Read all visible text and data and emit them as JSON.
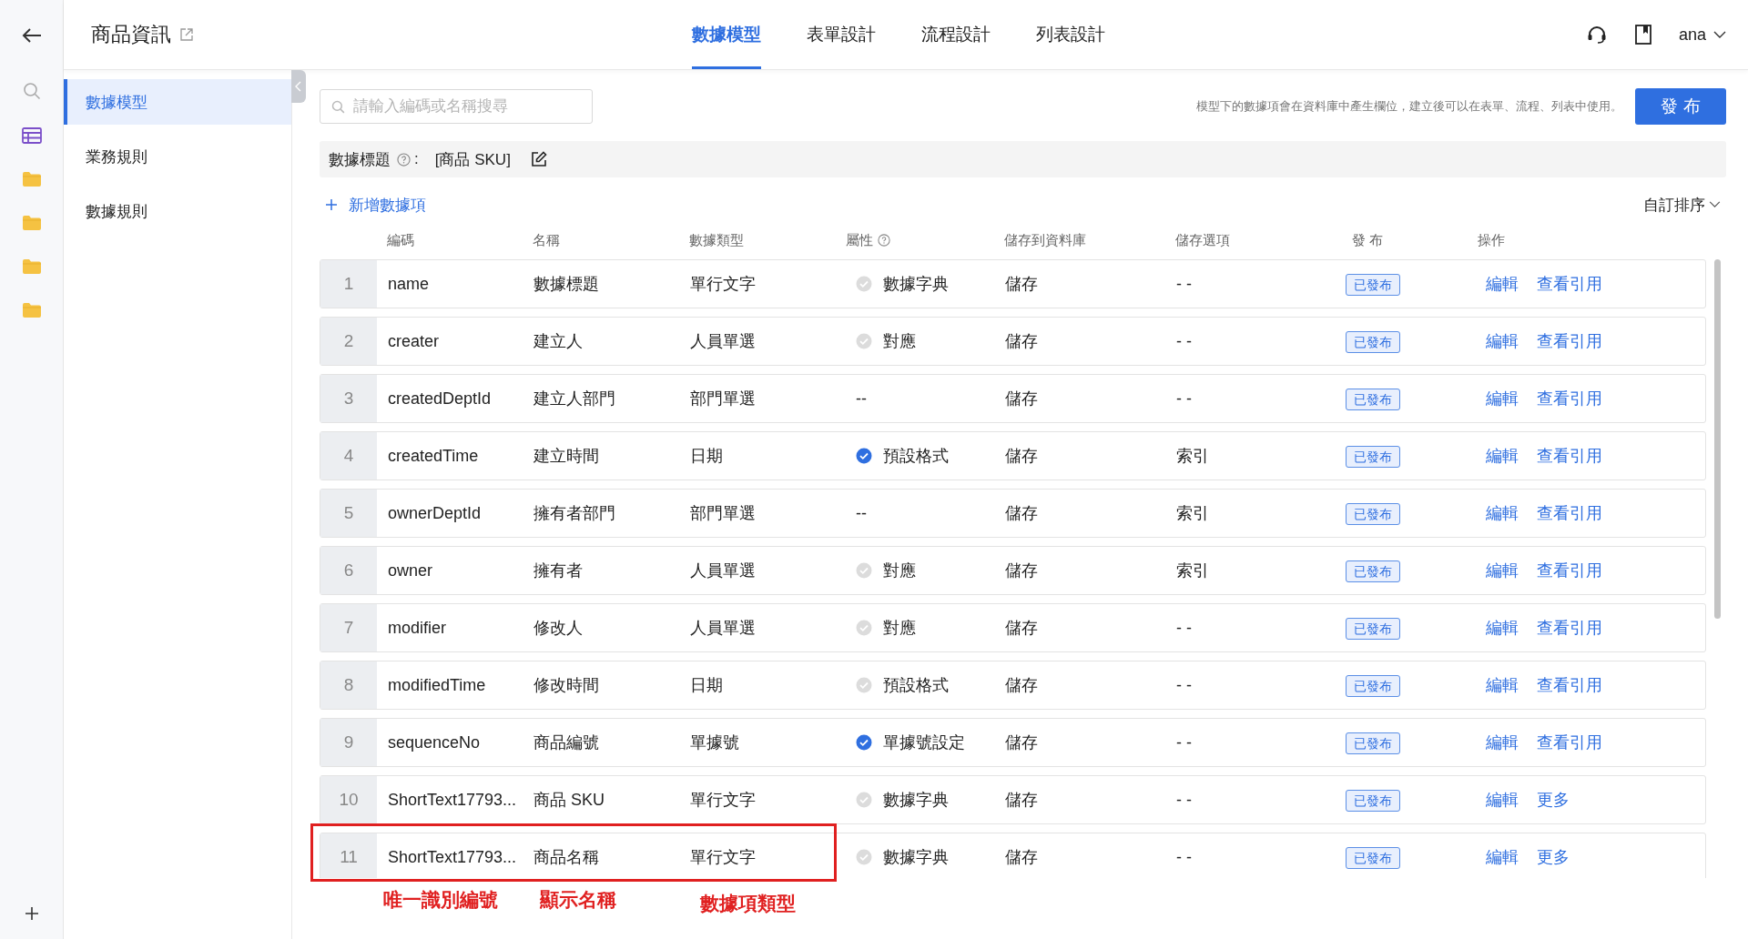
{
  "header": {
    "title": "商品資訊",
    "tabs": [
      {
        "label": "數據模型",
        "selected": true
      },
      {
        "label": "表單設計",
        "selected": false
      },
      {
        "label": "流程設計",
        "selected": false
      },
      {
        "label": "列表設計",
        "selected": false
      }
    ],
    "user": "ana"
  },
  "sidebar": {
    "items": [
      {
        "label": "數據模型",
        "selected": true
      },
      {
        "label": "業務規則",
        "selected": false
      },
      {
        "label": "數據規則",
        "selected": false
      }
    ]
  },
  "search": {
    "placeholder": "請輸入編碼或名稱搜尋"
  },
  "hint": "模型下的數據項會在資料庫中產生欄位，建立後可以在表單、流程、列表中使用。",
  "publish_button": "發 布",
  "data_title": {
    "label": "數據標題",
    "separator": ":",
    "value": "[商品 SKU]"
  },
  "add_item": "新增數據項",
  "sort": "自訂排序",
  "table": {
    "columns": [
      "編碼",
      "名稱",
      "數據類型",
      "屬性",
      "儲存到資料庫",
      "儲存選項",
      "發 布",
      "操作"
    ],
    "rows": [
      {
        "no": "1",
        "code": "name",
        "name": "數據標題",
        "type": "單行文字",
        "attr": {
          "kind": "check",
          "checked": false,
          "text": "數據字典"
        },
        "store": "儲存",
        "option": "- -",
        "status": "已發布",
        "actions": [
          "編輯",
          "查看引用"
        ]
      },
      {
        "no": "2",
        "code": "creater",
        "name": "建立人",
        "type": "人員單選",
        "attr": {
          "kind": "check",
          "checked": false,
          "text": "對應"
        },
        "store": "儲存",
        "option": "- -",
        "status": "已發布",
        "actions": [
          "編輯",
          "查看引用"
        ]
      },
      {
        "no": "3",
        "code": "createdDeptId",
        "name": "建立人部門",
        "type": "部門單選",
        "attr": {
          "kind": "plain",
          "text": "--"
        },
        "store": "儲存",
        "option": "- -",
        "status": "已發布",
        "actions": [
          "編輯",
          "查看引用"
        ]
      },
      {
        "no": "4",
        "code": "createdTime",
        "name": "建立時間",
        "type": "日期",
        "attr": {
          "kind": "check",
          "checked": true,
          "text": "預設格式"
        },
        "store": "儲存",
        "option": "索引",
        "status": "已發布",
        "actions": [
          "編輯",
          "查看引用"
        ]
      },
      {
        "no": "5",
        "code": "ownerDeptId",
        "name": "擁有者部門",
        "type": "部門單選",
        "attr": {
          "kind": "plain",
          "text": "--"
        },
        "store": "儲存",
        "option": "索引",
        "status": "已發布",
        "actions": [
          "編輯",
          "查看引用"
        ]
      },
      {
        "no": "6",
        "code": "owner",
        "name": "擁有者",
        "type": "人員單選",
        "attr": {
          "kind": "check",
          "checked": false,
          "text": "對應"
        },
        "store": "儲存",
        "option": "索引",
        "status": "已發布",
        "actions": [
          "編輯",
          "查看引用"
        ]
      },
      {
        "no": "7",
        "code": "modifier",
        "name": "修改人",
        "type": "人員單選",
        "attr": {
          "kind": "check",
          "checked": false,
          "text": "對應"
        },
        "store": "儲存",
        "option": "- -",
        "status": "已發布",
        "actions": [
          "編輯",
          "查看引用"
        ]
      },
      {
        "no": "8",
        "code": "modifiedTime",
        "name": "修改時間",
        "type": "日期",
        "attr": {
          "kind": "check",
          "checked": false,
          "text": "預設格式"
        },
        "store": "儲存",
        "option": "- -",
        "status": "已發布",
        "actions": [
          "編輯",
          "查看引用"
        ]
      },
      {
        "no": "9",
        "code": "sequenceNo",
        "name": "商品編號",
        "type": "單據號",
        "attr": {
          "kind": "check",
          "checked": true,
          "text": "單據號設定"
        },
        "store": "儲存",
        "option": "- -",
        "status": "已發布",
        "actions": [
          "編輯",
          "查看引用"
        ]
      },
      {
        "no": "10",
        "code": "ShortText17793...",
        "name": "商品 SKU",
        "type": "單行文字",
        "attr": {
          "kind": "check",
          "checked": false,
          "text": "數據字典"
        },
        "store": "儲存",
        "option": "- -",
        "status": "已發布",
        "actions": [
          "編輯",
          "更多"
        ]
      },
      {
        "no": "11",
        "code": "ShortText17793...",
        "name": "商品名稱",
        "type": "單行文字",
        "attr": {
          "kind": "check",
          "checked": false,
          "text": "數據字典"
        },
        "store": "儲存",
        "option": "- -",
        "status": "已發布",
        "actions": [
          "編輯",
          "更多"
        ]
      }
    ]
  },
  "annotations": [
    "唯一識別編號",
    "顯示名稱",
    "數據項類型"
  ]
}
